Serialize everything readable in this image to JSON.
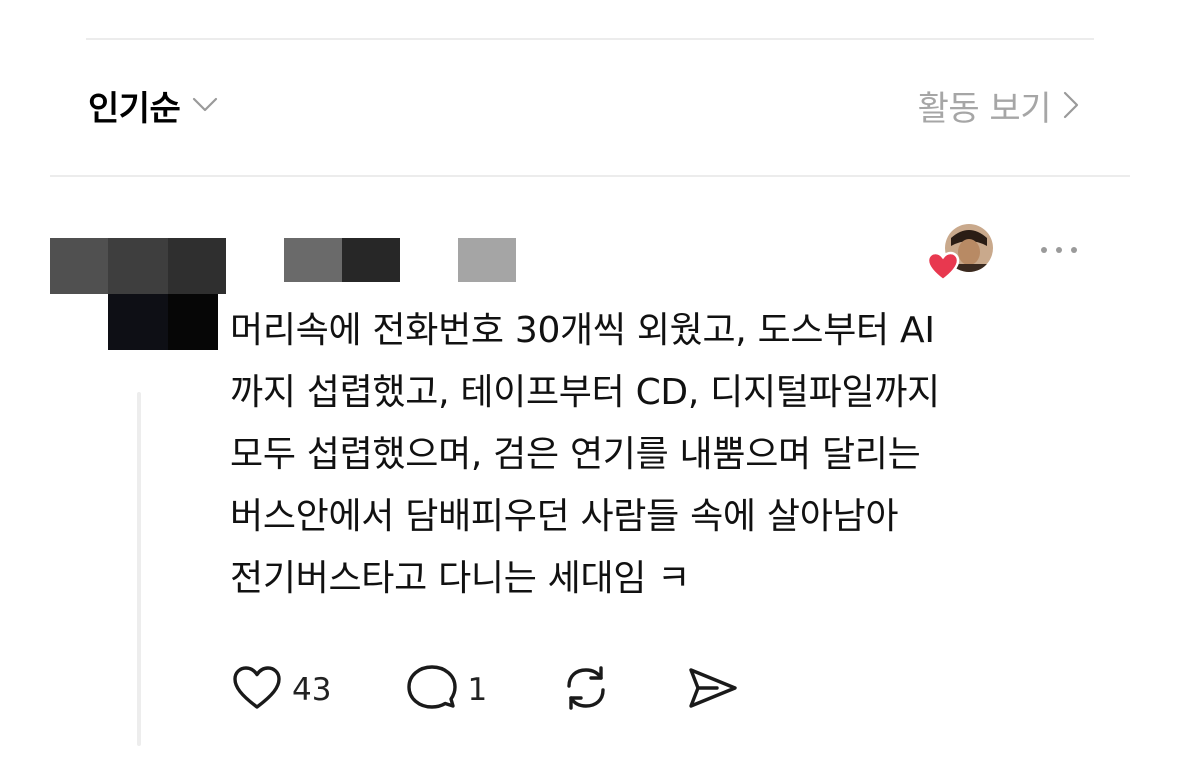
{
  "header": {
    "sort_label": "인기순",
    "sort_icon": "chevron-down-icon",
    "activity_label": "활동 보기",
    "activity_icon": "chevron-right-icon"
  },
  "post": {
    "text": "머리속에 전화번호 30개씩 외웠고, 도스부터 AI\n까지 섭렵했고, 테이프부터 CD, 디지털파일까지\n모두 섭렵했으며, 검은 연기를 내뿜으며 달리는\n버스안에서 담배피우던 사람들 속에 살아남아\n전기버스타고 다니는 세대임 ㅋ",
    "liked_badge_color": "#e8384f",
    "actions": {
      "like_icon": "heart-icon",
      "like_count": "43",
      "reply_icon": "comment-bubble-icon",
      "reply_count": "1",
      "repost_icon": "repost-icon",
      "share_icon": "send-icon"
    },
    "more_icon": "more-dots-icon"
  }
}
